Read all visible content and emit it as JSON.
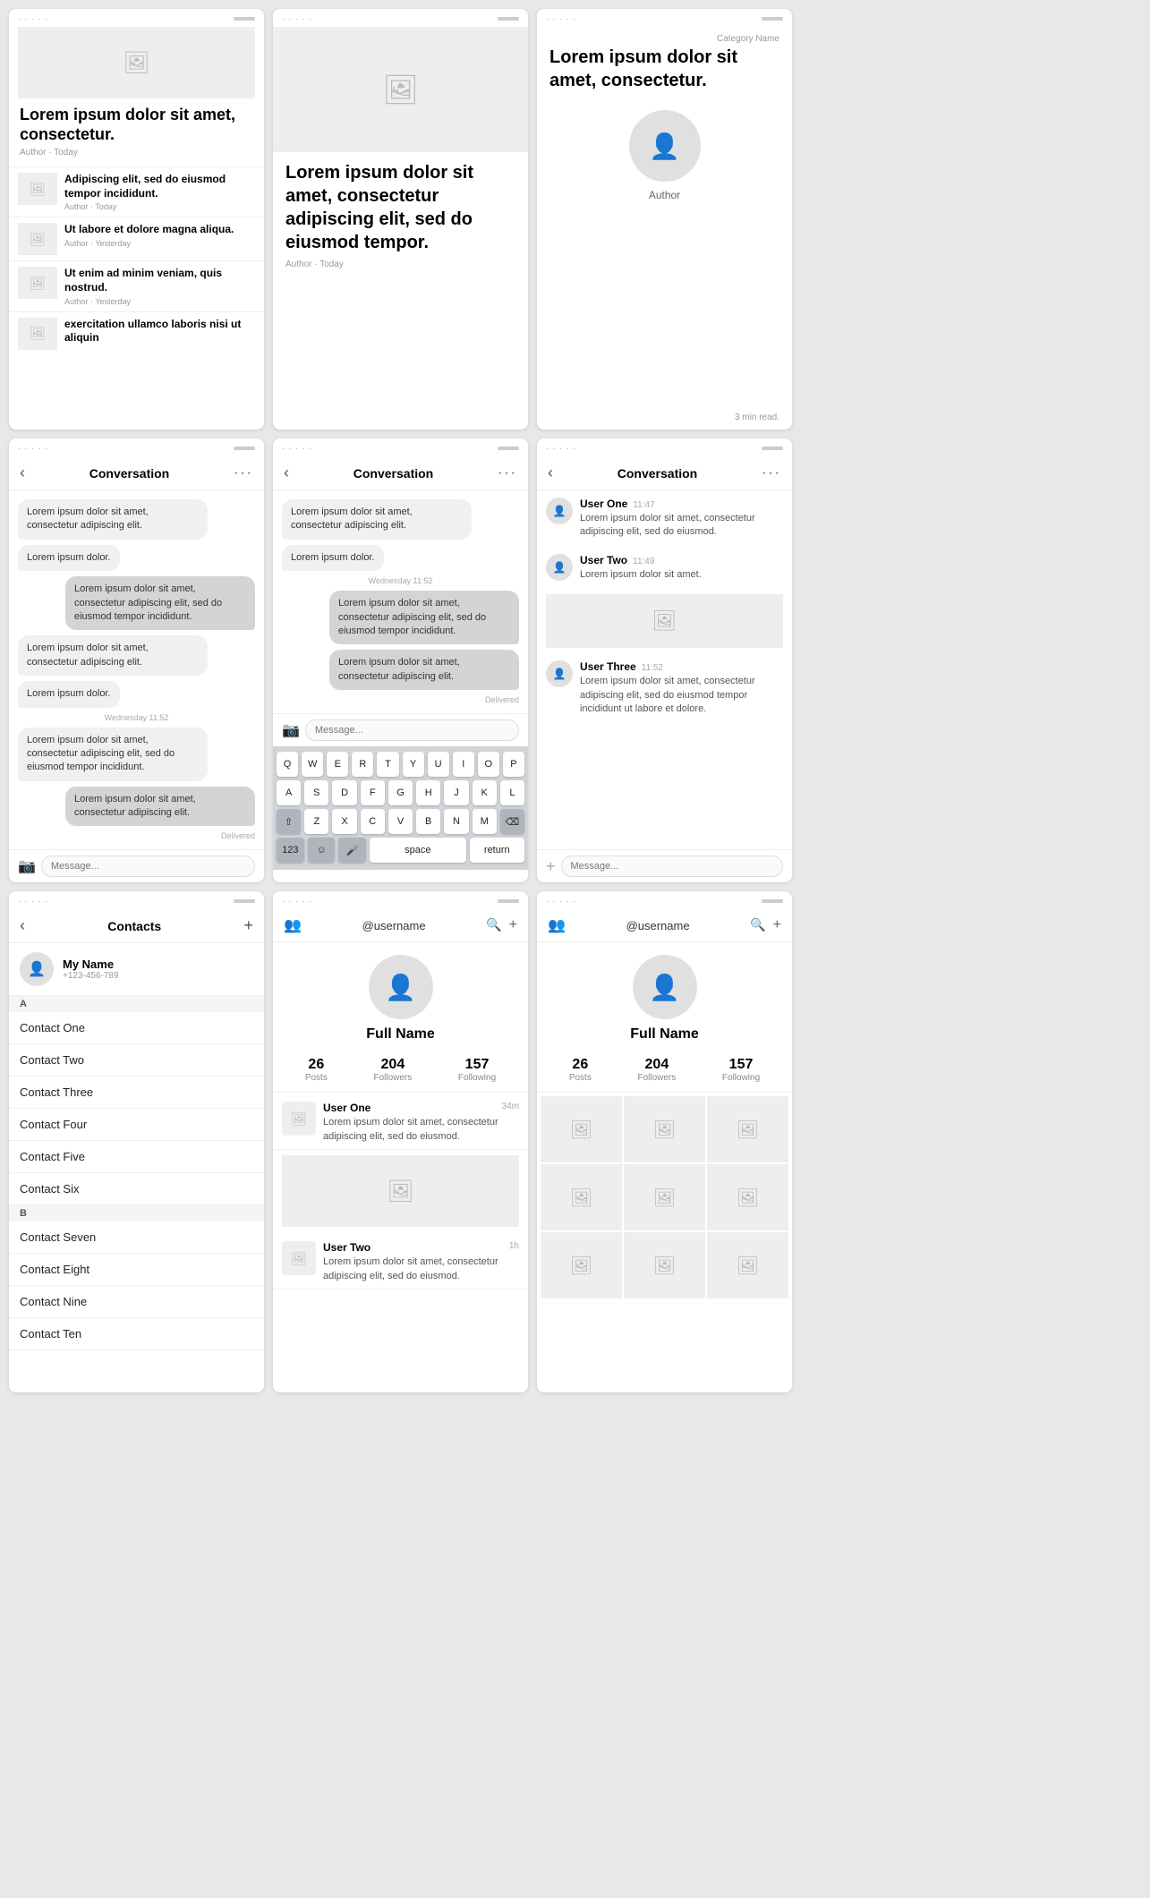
{
  "rows": {
    "row1": {
      "card1": {
        "hero_icon": "🖼",
        "title": "Lorem ipsum dolor sit amet, consectetur.",
        "meta": "Author · Today",
        "items": [
          {
            "icon": "🖼",
            "title": "Adipiscing elit, sed do eiusmod tempor incididunt.",
            "meta": "Author · Today"
          },
          {
            "icon": "🖼",
            "title": "Ut labore et dolore magna aliqua.",
            "meta": "Author · Yesterday"
          },
          {
            "icon": "🖼",
            "title": "Ut enim ad minim veniam, quis nostrud.",
            "meta": "Author · Yesterday"
          },
          {
            "icon": "🖼",
            "title": "exercitation ullamco laboris nisi ut aliquin",
            "meta": ""
          }
        ]
      },
      "card2": {
        "hero_icon": "🖼",
        "title": "Lorem ipsum dolor sit amet, consectetur adipiscing elit, sed do eiusmod tempor.",
        "meta": "Author · Today"
      },
      "card3": {
        "category": "Category Name",
        "title": "Lorem ipsum dolor sit amet, consectetur.",
        "author_label": "Author",
        "readtime": "3 min read."
      }
    },
    "row2": {
      "conv1": {
        "title": "Conversation",
        "messages": [
          {
            "side": "left",
            "text": "Lorem ipsum dolor sit amet, consectetur adipiscing elit."
          },
          {
            "side": "left",
            "text": "Lorem ipsum dolor."
          },
          {
            "side": "right",
            "text": "Lorem ipsum dolor sit amet, consectetur adipiscing elit, sed do eiusmod tempor incididunt."
          },
          {
            "side": "left",
            "text": "Lorem ipsum dolor sit amet, consectetur adipiscing elit."
          },
          {
            "side": "left",
            "text": "Lorem ipsum dolor."
          },
          {
            "timestamp": "Wednesday 11:52"
          },
          {
            "side": "left",
            "text": "Lorem ipsum dolor sit amet, consectetur adipiscing elit, sed do eiusmod tempor incididunt."
          },
          {
            "side": "right",
            "text": "Lorem ipsum dolor sit amet, consectetur adipiscing elit."
          },
          {
            "delivered": "Delivered"
          }
        ],
        "input_placeholder": "Message...",
        "input_icon": "📷"
      },
      "conv2": {
        "title": "Conversation",
        "messages": [
          {
            "side": "left",
            "text": "Lorem ipsum dolor sit amet, consectetur adipiscing elit."
          },
          {
            "side": "left",
            "text": "Lorem ipsum dolor."
          },
          {
            "timestamp": "Wednesday 11:52"
          },
          {
            "side": "right",
            "text": "Lorem ipsum dolor sit amet, consectetur adipiscing elit, sed do eiusmod tempor incididunt."
          },
          {
            "side": "right",
            "text": "Lorem ipsum dolor sit amet, consectetur adipiscing elit."
          },
          {
            "delivered": "Delivered"
          }
        ],
        "input_placeholder": "Message...",
        "keyboard": {
          "rows": [
            [
              "Q",
              "W",
              "E",
              "R",
              "T",
              "Y",
              "U",
              "I",
              "O",
              "P"
            ],
            [
              "A",
              "S",
              "D",
              "F",
              "G",
              "H",
              "J",
              "K",
              "L"
            ],
            [
              "⇧",
              "Z",
              "X",
              "C",
              "V",
              "B",
              "N",
              "M",
              "⌫"
            ],
            [
              "123",
              "☺",
              "🎤",
              "space",
              "return"
            ]
          ]
        }
      },
      "conv3": {
        "title": "Conversation",
        "users": [
          {
            "name": "User One",
            "time": "11:47",
            "text": "Lorem ipsum dolor sit amet, consectetur adipiscing elit, sed do eiusmod."
          },
          {
            "name": "User Two",
            "time": "11:49",
            "text": "Lorem ipsum dolor sit amet."
          },
          {
            "has_image": true
          },
          {
            "name": "User Three",
            "time": "11:52",
            "text": "Lorem ipsum dolor sit amet, consectetur adipiscing elit, sed do eiusmod tempor incididunt ut labore et dolore."
          }
        ],
        "input_placeholder": "Message..."
      }
    },
    "row3": {
      "contacts": {
        "title": "Contacts",
        "myname": "My Name",
        "myphone": "+123-456-789",
        "section_a": "A",
        "section_b": "B",
        "contacts_a": [
          "Contact One",
          "Contact Two",
          "Contact Three",
          "Contact Four",
          "Contact Five",
          "Contact Six"
        ],
        "contacts_b": [
          "Contact Seven",
          "Contact Eight",
          "Contact Nine",
          "Contact Ten"
        ]
      },
      "profile1": {
        "username": "@username",
        "fullname": "Full Name",
        "stats": {
          "posts": "26",
          "posts_label": "Posts",
          "followers": "204",
          "followers_label": "Followers",
          "following": "157",
          "following_label": "Following"
        },
        "feed": [
          {
            "username": "User One",
            "time": "34m",
            "text": "Lorem ipsum dolor sit amet, consectetur adipiscing elit, sed do eiusmod."
          },
          {
            "username": "User Two",
            "time": "1h",
            "text": "Lorem ipsum dolor sit amet, consectetur adipiscing elit, sed do eiusmod."
          }
        ]
      },
      "profile2": {
        "username": "@username",
        "fullname": "Full Name",
        "stats": {
          "posts": "26",
          "posts_label": "Posts",
          "followers": "204",
          "followers_label": "Followers",
          "following": "157",
          "following_label": "Following"
        },
        "grid_rows": 2
      }
    }
  }
}
